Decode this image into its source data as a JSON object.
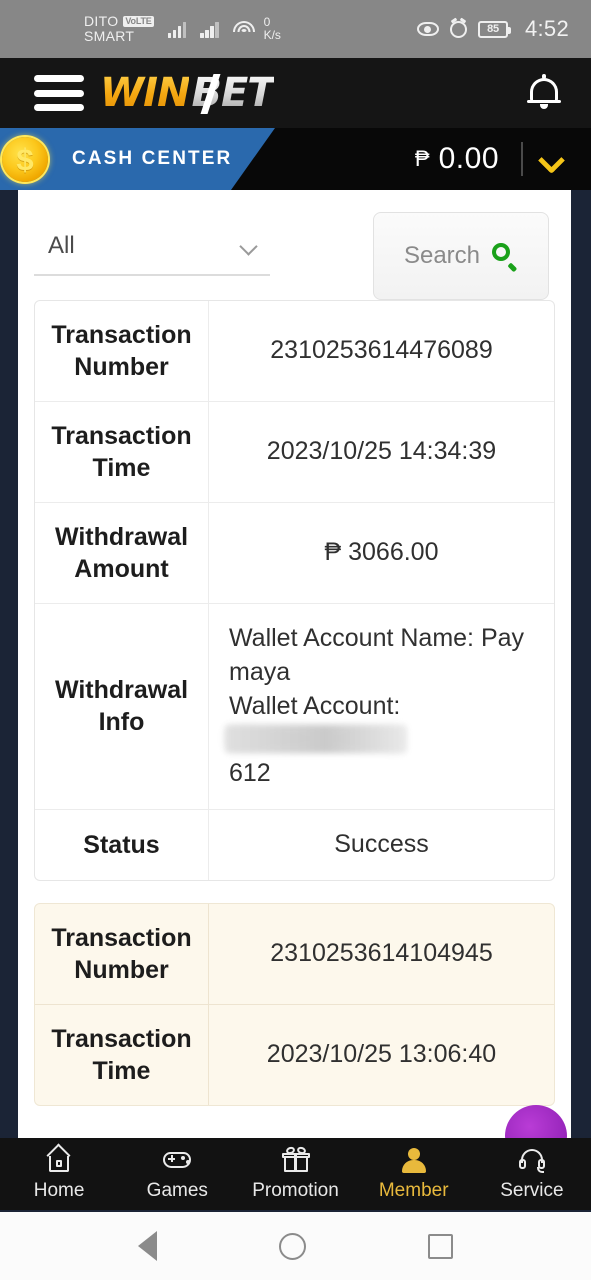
{
  "status_bar": {
    "carrier_primary": "DITO",
    "carrier_badge": "VoLTE",
    "carrier_secondary": "SMART",
    "data_rate_value": "0",
    "data_rate_unit": "K/s",
    "battery_level": "85",
    "time": "4:52",
    "icons": [
      "eye-icon",
      "alarm-icon",
      "battery-icon"
    ]
  },
  "app_header": {
    "logo_primary": "WIN",
    "logo_secondary": "BET",
    "menu_icon": "hamburger-menu-icon",
    "notification_icon": "bell-icon"
  },
  "cash_bar": {
    "title": "CASH CENTER",
    "currency_symbol": "₱",
    "balance": "0.00",
    "coin_symbol": "$",
    "expand_icon": "chevron-down-icon",
    "banner_color": "#2a69ad",
    "accent_color": "#f5c518"
  },
  "filter": {
    "select_value": "All",
    "select_chevron": "chevron-down-icon",
    "search_label": "Search",
    "search_icon": "search-icon",
    "search_icon_color": "#1aa11a"
  },
  "transactions": [
    {
      "highlight": false,
      "rows": [
        {
          "label": "Transaction Number",
          "value": "2310253614476089",
          "align": "center"
        },
        {
          "label": "Transaction Time",
          "value": "2023/10/25 14:34:39",
          "align": "center"
        },
        {
          "label": "Withdrawal Amount",
          "value": "₱ 3066.00",
          "align": "center"
        },
        {
          "label": "Withdrawal Info",
          "value": "",
          "align": "left",
          "info_line1": "Wallet Account Name: Pay maya",
          "info_line2_prefix": "Wallet Account: ",
          "info_line2_masked": "09XXXXXXX41",
          "info_line3": "612"
        },
        {
          "label": "Status",
          "value": "Success",
          "align": "center"
        }
      ]
    },
    {
      "highlight": true,
      "rows": [
        {
          "label": "Transaction Number",
          "value": "2310253614104945",
          "align": "center"
        },
        {
          "label": "Transaction Time",
          "value": "2023/10/25 13:06:40",
          "align": "center"
        }
      ]
    }
  ],
  "fab": {
    "name": "floating-action-button",
    "color": "#9b28be"
  },
  "bottom_nav": {
    "items": [
      {
        "label": "Home",
        "icon": "home-icon",
        "active": false
      },
      {
        "label": "Games",
        "icon": "gamepad-icon",
        "active": false
      },
      {
        "label": "Promotion",
        "icon": "gift-icon",
        "active": false
      },
      {
        "label": "Member",
        "icon": "user-icon",
        "active": true
      },
      {
        "label": "Service",
        "icon": "headset-icon",
        "active": false
      }
    ],
    "active_color": "#e8b93c"
  },
  "android_nav": {
    "back_icon": "back-triangle-icon",
    "home_icon": "home-circle-icon",
    "recents_icon": "recents-square-icon"
  }
}
